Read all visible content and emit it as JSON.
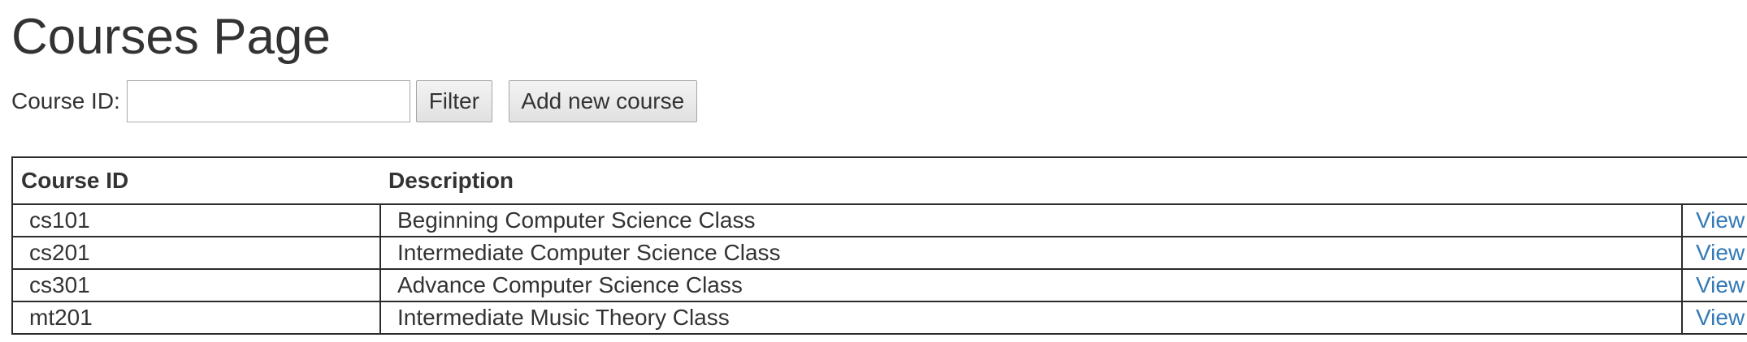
{
  "page": {
    "title": "Courses Page"
  },
  "filter": {
    "label": "Course ID:",
    "input_value": "",
    "input_placeholder": "",
    "filter_button": "Filter",
    "add_button": "Add new course"
  },
  "table": {
    "headers": {
      "course_id": "Course ID",
      "description": "Description",
      "action": ""
    },
    "rows": [
      {
        "course_id": "cs101",
        "description": "Beginning Computer Science Class",
        "action": "View"
      },
      {
        "course_id": "cs201",
        "description": "Intermediate Computer Science Class",
        "action": "View"
      },
      {
        "course_id": "cs301",
        "description": "Advance Computer Science Class",
        "action": "View"
      },
      {
        "course_id": "mt201",
        "description": "Intermediate Music Theory Class",
        "action": "View"
      }
    ]
  },
  "colors": {
    "text": "#333333",
    "link": "#337ab7",
    "border": "#2b2b2b"
  }
}
